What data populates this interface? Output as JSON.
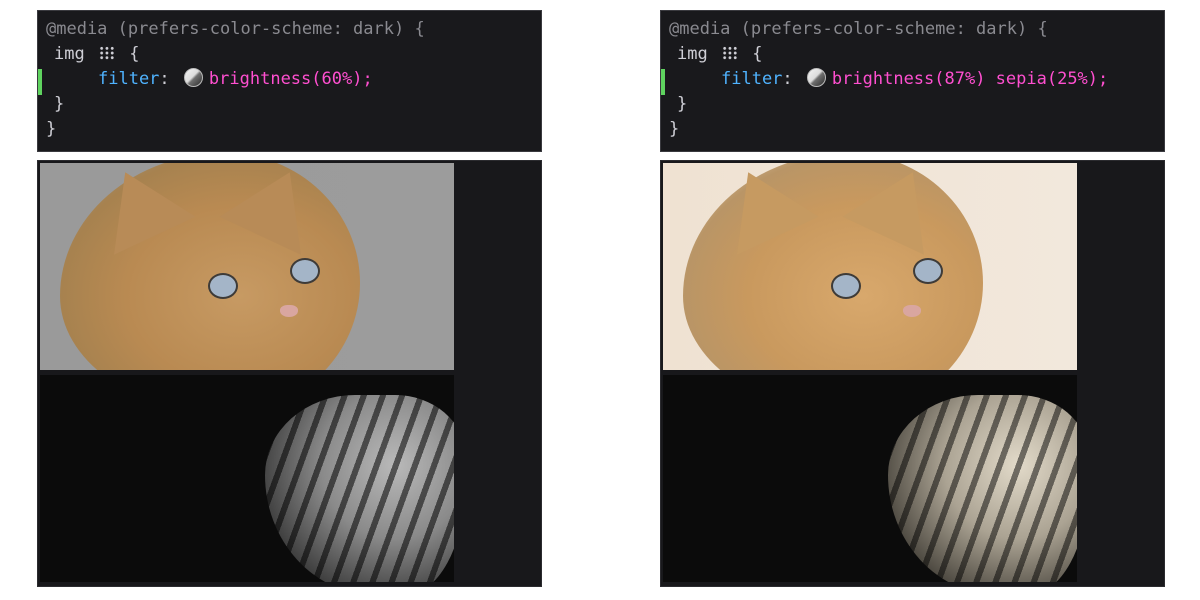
{
  "left": {
    "code": {
      "line1": "@media (prefers-color-scheme: dark) {",
      "line2_selector": "img",
      "line2_brace": "{",
      "line3_prop": "filter",
      "line3_colon": ":",
      "line3_value": "brightness(60%);",
      "line4": "}",
      "line5": "}"
    }
  },
  "right": {
    "code": {
      "line1": "@media (prefers-color-scheme: dark) {",
      "line2_selector": "img",
      "line2_brace": "{",
      "line3_prop": "filter",
      "line3_colon": ":",
      "line3_value": "brightness(87%) sepia(25%);",
      "line4": "}",
      "line5": "}"
    }
  },
  "icons": {
    "grid": "grid-icon",
    "filter_swatch": "filter-swatch-icon"
  },
  "colors": {
    "editor_bg": "#19191c",
    "property": "#4fb3ff",
    "value": "#ff4fd0",
    "muted": "#8a8a90",
    "change_marker": "#5fd35f"
  }
}
